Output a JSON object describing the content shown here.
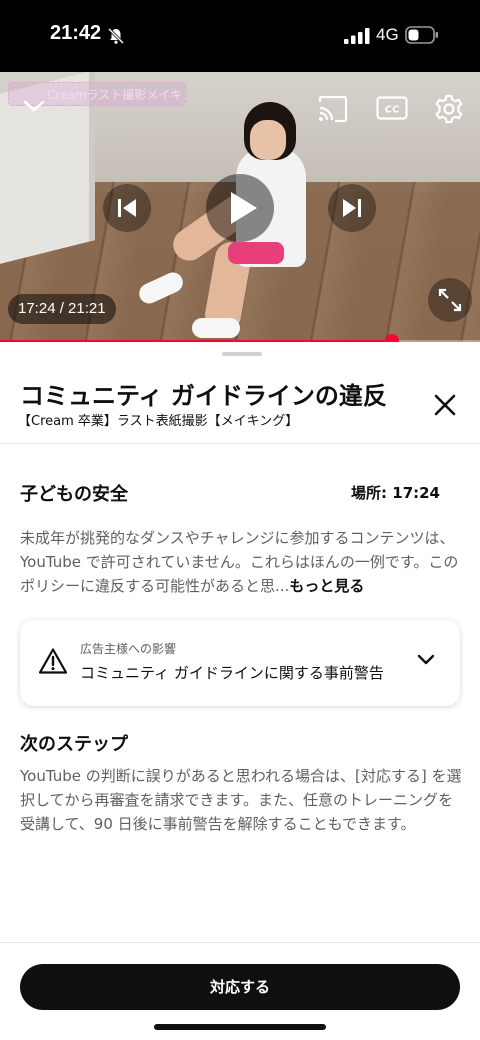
{
  "status_bar": {
    "time": "21:42",
    "network": "4G",
    "icons": [
      "bell-slash-icon",
      "signal-icon",
      "battery-icon"
    ]
  },
  "video": {
    "overlay_title": "Creamラスト撮影メイキング",
    "time_readout": "17:24 / 21:21",
    "progress_fraction": 0.8158,
    "icons": [
      "chevron-down-icon",
      "cast-icon",
      "cc-icon",
      "settings-icon",
      "previous-icon",
      "play-icon",
      "next-icon",
      "fullscreen-icon"
    ],
    "colors": {
      "progress": "#ff0033"
    }
  },
  "sheet": {
    "title": "コミュニティ ガイドラインの違反",
    "subtitle": "【Cream 卒業】ラスト表紙撮影【メイキング】",
    "policy": {
      "heading": "子どもの安全",
      "location": "場所: 17:24",
      "text": "未成年が挑発的なダンスやチャレンジに参加するコンテンツは、YouTube で許可されていません。これらはほんの一例です。このポリシーに違反する可能性があると思...",
      "more_label": "もっと見る"
    },
    "impact": {
      "caption": "広告主様への影響",
      "label": "コミュニティ ガイドラインに関する事前警告"
    },
    "next_steps": {
      "heading": "次のステップ",
      "text": "YouTube の判断に誤りがあると思われる場合は、[対応する] を選択してから再審査を請求できます。また、任意のトレーニングを受講して、90 日後に事前警告を解除することもできます。"
    },
    "action_label": "対応する"
  }
}
